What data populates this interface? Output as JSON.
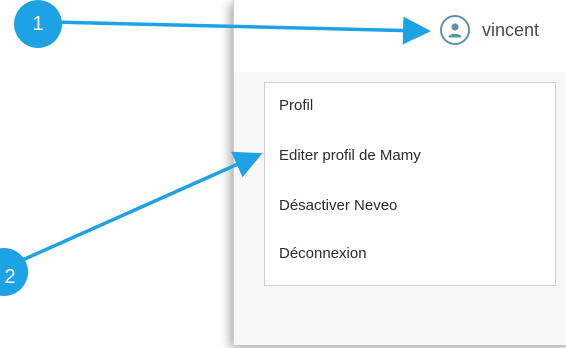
{
  "header": {
    "username": "vincent",
    "avatar_icon": "user-avatar-icon",
    "accent_color": "#5f93aa"
  },
  "dropdown": {
    "items": [
      {
        "label": "Profil"
      },
      {
        "label": "Editer profil de Mamy"
      },
      {
        "label": "Désactiver Neveo"
      },
      {
        "label": "Déconnexion"
      }
    ]
  },
  "annotations": {
    "callout_color": "#1ea2e6",
    "callouts": [
      {
        "number": "1"
      },
      {
        "number": "2"
      }
    ]
  }
}
